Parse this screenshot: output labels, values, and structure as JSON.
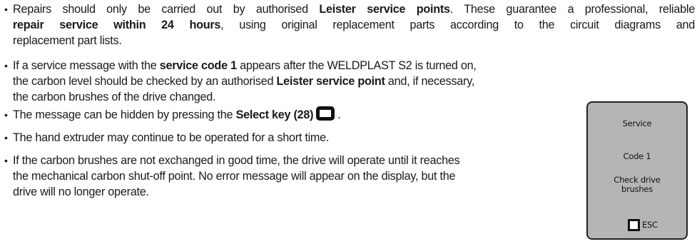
{
  "bullets": {
    "b1": {
      "t1": "Repairs should only be carried out by authorised ",
      "t2": "Leister service points",
      "t3": ". These guarantee a professional, reliable",
      "t4": "repair service within 24 hours",
      "t5": ", using original replacement parts according to the circuit diagrams and",
      "t6": "replacement part lists."
    },
    "b2": {
      "t1": "If a service message with the ",
      "t2": "service code 1",
      "t3": " appears after the WELDPLAST S2 is turned on,",
      "t4": "the carbon level should be checked by an authorised ",
      "t5": "Leister service point",
      "t6": " and, if necessary,",
      "t7": "the carbon brushes of the drive changed."
    },
    "b3": {
      "t1": "The message can be hidden by pressing the ",
      "t2": "Select key (28)",
      "t3": "."
    },
    "b4": {
      "t1": "The hand extruder may continue to be operated for a short time."
    },
    "b5": {
      "t1": "If the carbon brushes are not exchanged in good time, the drive will operate until it reaches",
      "t2": "the mechanical carbon shut-off point. No error message will appear on the display, but the",
      "t3": "drive will no longer operate."
    },
    "dot": "•"
  },
  "panel": {
    "title": "Service",
    "code": "Code 1",
    "msg_line1": "Check drive",
    "msg_line2": "brushes",
    "esc": "ESC"
  }
}
